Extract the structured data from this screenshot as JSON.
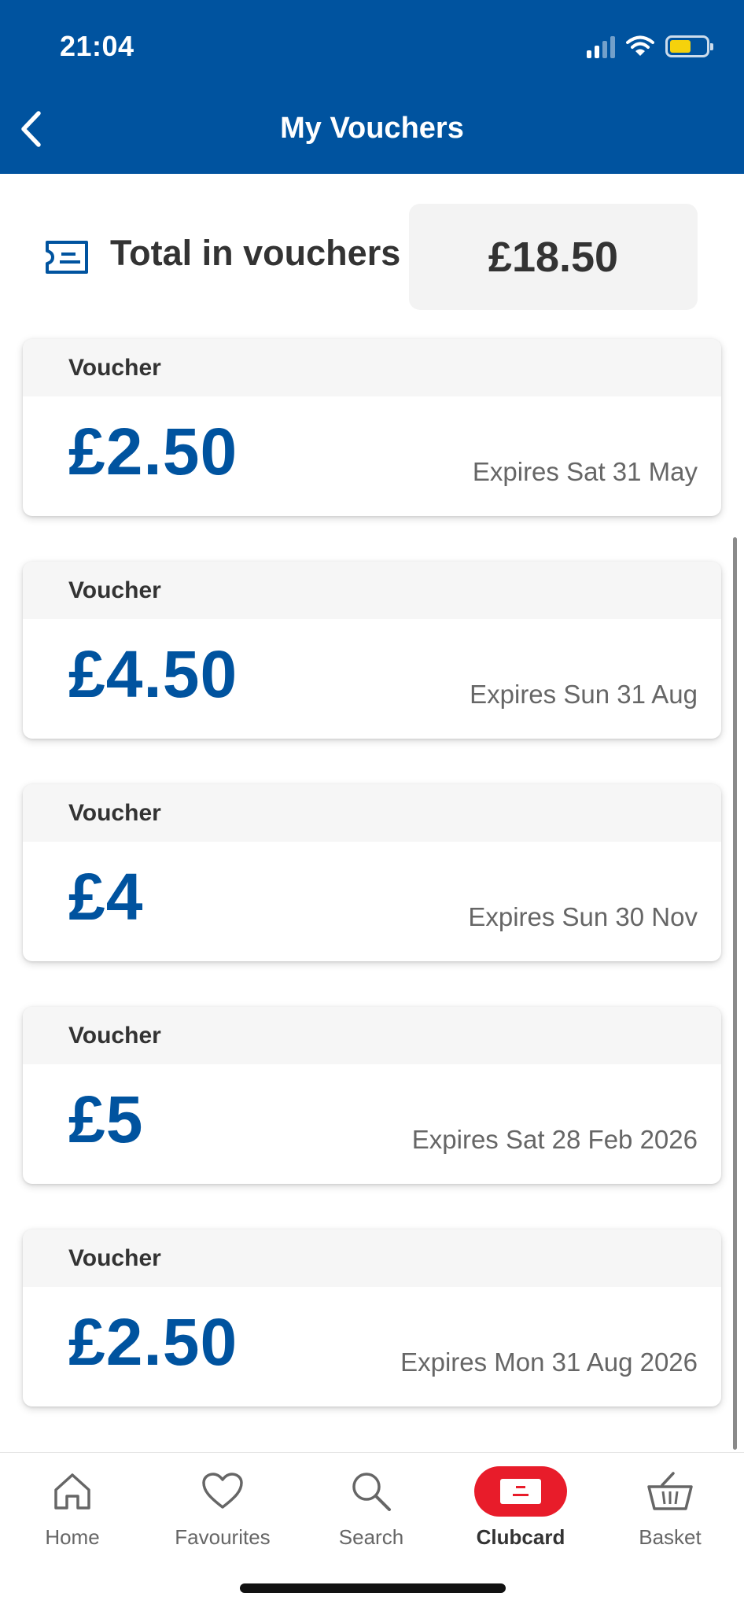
{
  "status_bar": {
    "time": "21:04"
  },
  "header": {
    "title": "My Vouchers"
  },
  "summary": {
    "label": "Total in vouchers",
    "total": "£18.50"
  },
  "vouchers": [
    {
      "heading": "Voucher",
      "amount": "£2.50",
      "expiry": "Expires Sat 31 May"
    },
    {
      "heading": "Voucher",
      "amount": "£4.50",
      "expiry": "Expires Sun 31 Aug"
    },
    {
      "heading": "Voucher",
      "amount": "£4",
      "expiry": "Expires Sun 30 Nov"
    },
    {
      "heading": "Voucher",
      "amount": "£5",
      "expiry": "Expires Sat 28 Feb 2026"
    },
    {
      "heading": "Voucher",
      "amount": "£2.50",
      "expiry": "Expires Mon 31 Aug 2026"
    }
  ],
  "nav": {
    "items": [
      {
        "label": "Home",
        "icon": "home-icon"
      },
      {
        "label": "Favourites",
        "icon": "heart-icon"
      },
      {
        "label": "Search",
        "icon": "search-icon"
      },
      {
        "label": "Clubcard",
        "icon": "clubcard-icon",
        "active": true
      },
      {
        "label": "Basket",
        "icon": "basket-icon"
      }
    ]
  },
  "colors": {
    "brand_blue": "#00539f",
    "clubcard_red": "#e81c2a",
    "battery_yellow": "#f5d20c"
  }
}
